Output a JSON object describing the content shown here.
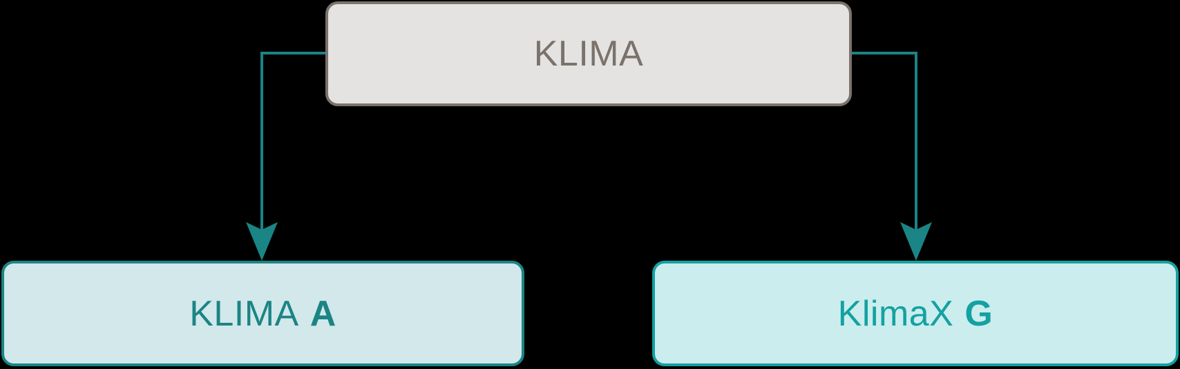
{
  "diagram": {
    "root": {
      "label": "KLIMA"
    },
    "children": [
      {
        "label_regular": "KLIMA",
        "label_bold": "A"
      },
      {
        "label_regular": "KlimaX",
        "label_bold": "G"
      }
    ],
    "colors": {
      "background": "#000000",
      "root_fill": "#e4e3e1",
      "root_stroke": "#7a726b",
      "root_text": "#7a726b",
      "left_fill": "#d2e8ea",
      "left_stroke": "#1b8485",
      "right_fill": "#cbeded",
      "right_stroke": "#14a1a2",
      "connector": "#1b8485"
    }
  }
}
